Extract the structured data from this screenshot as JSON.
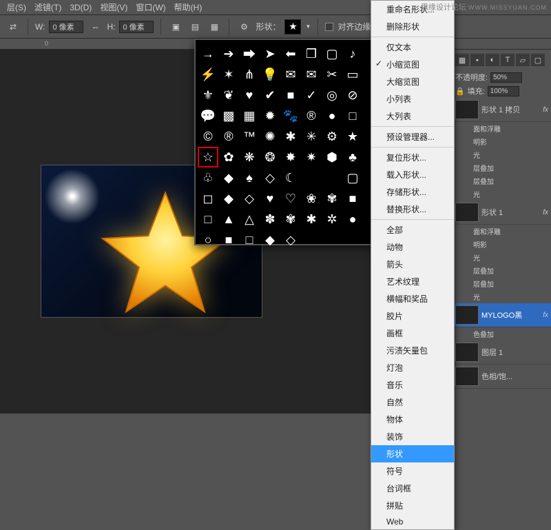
{
  "branding": {
    "site": "思缘设计论坛",
    "url": "WWW.MISSYUAN.COM"
  },
  "menubar": {
    "items": [
      "层(S)",
      "滤镜(T)",
      "3D(D)",
      "视图(V)",
      "窗口(W)",
      "帮助(H)"
    ]
  },
  "optbar": {
    "w_label": "W:",
    "w_value": "0 像素",
    "link_icon": "link-icon",
    "h_label": "H:",
    "h_value": "0 像素",
    "shape_label": "形状：",
    "align_edges_label": "对齐边缘"
  },
  "shape_picker": {
    "selected_index": 40,
    "shapes": [
      "arrow-thin-right",
      "arrow-solid-right",
      "block-arrow",
      "arrow-point-right",
      "block-arrow-back",
      "callout-square",
      "frame-sq",
      "music-note",
      "lightning",
      "burst",
      "grass",
      "lightbulb",
      "envelope-front",
      "envelope",
      "scissors",
      "frame-rect",
      "fleur",
      "ornament",
      "heart",
      "checkmark",
      "square",
      "check",
      "target",
      "prohibit",
      "speech",
      "checker",
      "grid",
      "starburst",
      "paw",
      "registered",
      "circle-heavy",
      "outline-sq",
      "copyright",
      "registered2",
      "tm",
      "burst2",
      "hex-spin",
      "starburst-thin",
      "gear",
      "star-solid",
      "star-outline",
      "seal-8",
      "seal-8-out",
      "seal-10",
      "burst3",
      "burst4",
      "hexagon",
      "club",
      "club-out",
      "diamond",
      "spade",
      "diamond-out",
      "moon",
      "",
      "",
      "rounded-sq",
      "rounded-open",
      "diamond2",
      "diamond-open",
      "heart2",
      "heart-open",
      "seal-open",
      "seal-open2",
      "rounded-sq2",
      "sq-hollow",
      "triangle",
      "triangle-open",
      "blob",
      "blob-open",
      "asterisk",
      "asterisk2",
      "circle",
      "ring",
      "square-solid",
      "square-open",
      "diamond3",
      "diamond-open2",
      "",
      ""
    ]
  },
  "ctxmenu": {
    "items": [
      {
        "label": "重命名形状..."
      },
      {
        "label": "删除形状"
      },
      {
        "sep": true
      },
      {
        "label": "仅文本"
      },
      {
        "label": "小缩览图",
        "checked": true
      },
      {
        "label": "大缩览图"
      },
      {
        "label": "小列表"
      },
      {
        "label": "大列表"
      },
      {
        "sep": true
      },
      {
        "label": "预设管理器..."
      },
      {
        "sep": true
      },
      {
        "label": "复位形状..."
      },
      {
        "label": "载入形状..."
      },
      {
        "label": "存储形状..."
      },
      {
        "label": "替换形状..."
      },
      {
        "sep": true
      },
      {
        "label": "全部"
      },
      {
        "label": "动物"
      },
      {
        "label": "箭头"
      },
      {
        "label": "艺术纹理"
      },
      {
        "label": "横幅和奖品"
      },
      {
        "label": "胶片"
      },
      {
        "label": "画框"
      },
      {
        "label": "污渍矢量包"
      },
      {
        "label": "灯泡"
      },
      {
        "label": "音乐"
      },
      {
        "label": "自然"
      },
      {
        "label": "物体"
      },
      {
        "label": "装饰"
      },
      {
        "label": "形状",
        "hl": true
      },
      {
        "label": "符号"
      },
      {
        "label": "台词框"
      },
      {
        "label": "拼贴"
      },
      {
        "label": "Web"
      }
    ]
  },
  "layers": {
    "opacity_label": "不透明度:",
    "opacity_val": "50%",
    "fill_label": "填充:",
    "fill_val": "100%",
    "lock_icon": "lock-icon",
    "items": [
      {
        "name": "形状 1 拷贝",
        "fx": true,
        "effects": [
          "面和浮雕",
          "明影",
          "光",
          "层叠加",
          "层叠加",
          "光"
        ]
      },
      {
        "name": "形状 1",
        "fx": true,
        "effects": [
          "面和浮雕",
          "明影",
          "光",
          "层叠加",
          "层叠加",
          "光"
        ]
      },
      {
        "name": "MYLOGO黑",
        "fx": true,
        "sel": true
      },
      {
        "name": "色叠加",
        "sub": true
      },
      {
        "name": "图层 1",
        "thumb": "cloud"
      },
      {
        "name": "色相/饱...",
        "thumb": "adj"
      }
    ]
  }
}
